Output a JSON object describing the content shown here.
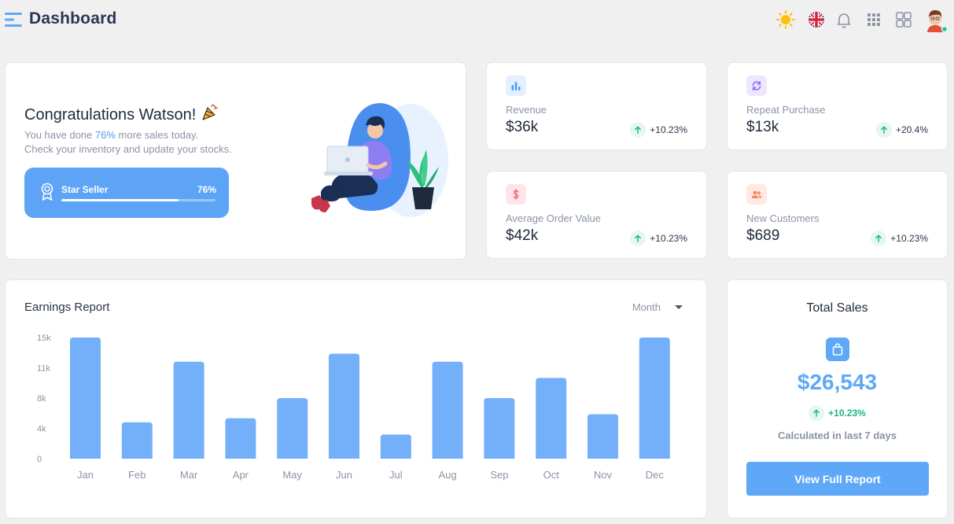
{
  "header": {
    "title": "Dashboard",
    "icons": [
      "menu-icon",
      "sun-icon",
      "uk-flag-icon",
      "bell-icon",
      "apps-grid-icon",
      "layout-icon",
      "user-avatar"
    ]
  },
  "welcome": {
    "title": "Congratulations Watson!",
    "line1_pre": "You have done ",
    "line1_highlight": "76%",
    "line1_post": " more sales today.",
    "line2": "Check your inventory and update your stocks.",
    "star_label": "Star Seller",
    "star_percent": "76%",
    "star_progress": 0.76
  },
  "stats": [
    {
      "label": "Revenue",
      "value": "$36k",
      "change": "+10.23%",
      "icon": "bar-chart-icon",
      "color": "#4f9bf5",
      "bg": "#e4efff"
    },
    {
      "label": "Repeat Purchase",
      "value": "$13k",
      "change": "+20.4%",
      "icon": "refresh-icon",
      "color": "#8b6cf6",
      "bg": "#ece7ff"
    },
    {
      "label": "Average Order Value",
      "value": "$42k",
      "change": "+10.23%",
      "icon": "dollar-icon",
      "color": "#f0627a",
      "bg": "#ffe5ea"
    },
    {
      "label": "New Customers",
      "value": "$689",
      "change": "+10.23%",
      "icon": "users-icon",
      "color": "#f58a5e",
      "bg": "#ffeae1"
    }
  ],
  "earnings": {
    "title": "Earnings Report",
    "period": "Month"
  },
  "total_sales": {
    "title": "Total Sales",
    "amount": "$26,543",
    "change": "+10.23%",
    "note": "Calculated in last 7 days",
    "button": "View Full Report"
  },
  "colors": {
    "accent": "#5ea8f7",
    "bar": "#74b0fa",
    "positive": "#20b486"
  },
  "chart_data": {
    "type": "bar",
    "title": "Earnings Report",
    "categories": [
      "Jan",
      "Feb",
      "Mar",
      "Apr",
      "May",
      "Jun",
      "Jul",
      "Aug",
      "Sep",
      "Oct",
      "Nov",
      "Dec"
    ],
    "values": [
      15000,
      4500,
      12000,
      5000,
      7500,
      13000,
      3000,
      12000,
      7500,
      10000,
      5500,
      15000
    ],
    "yticks": [
      "15k",
      "11k",
      "8k",
      "4k",
      "0"
    ],
    "ylim": [
      0,
      15000
    ],
    "grid": false
  }
}
